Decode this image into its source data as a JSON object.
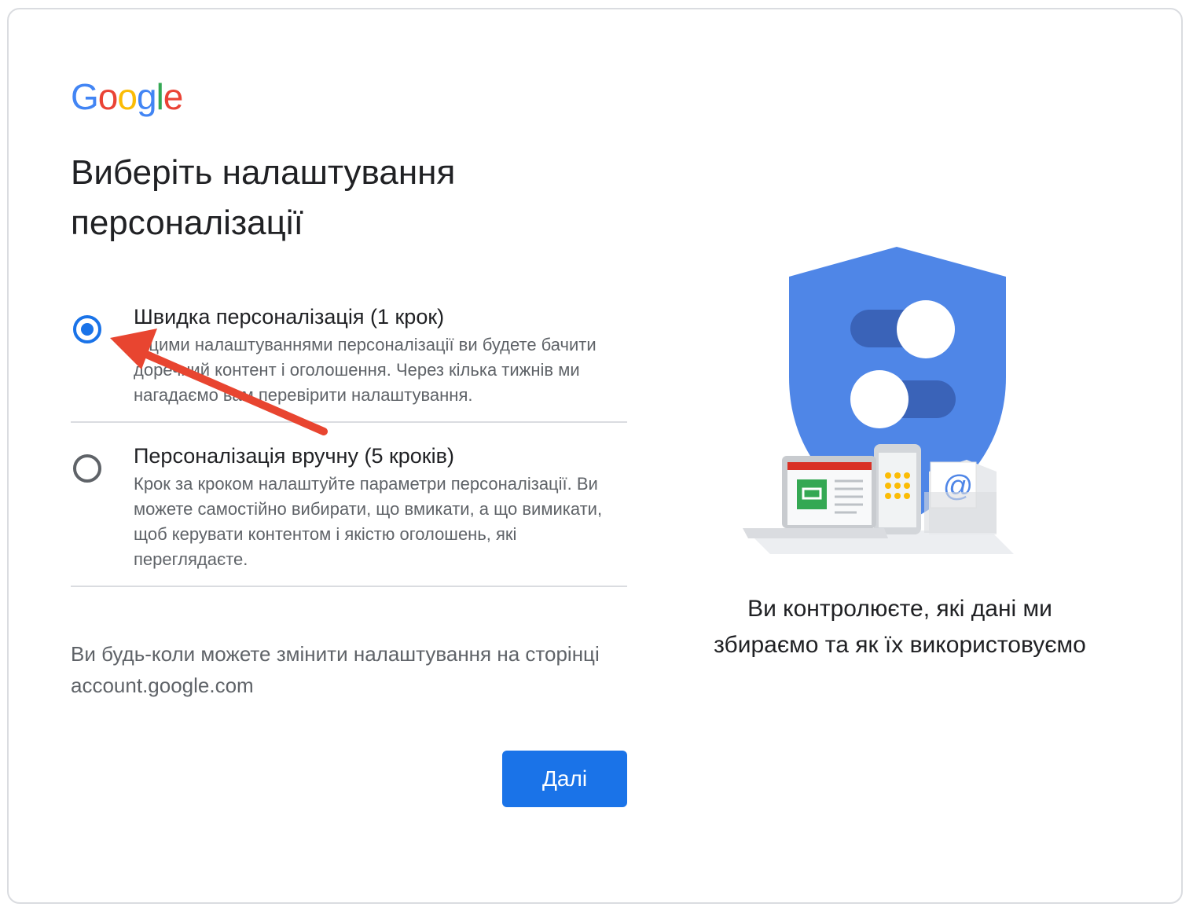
{
  "logo": {
    "letters": [
      {
        "char": "G",
        "color": "#4285F4"
      },
      {
        "char": "o",
        "color": "#EA4335"
      },
      {
        "char": "o",
        "color": "#FBBC05"
      },
      {
        "char": "g",
        "color": "#4285F4"
      },
      {
        "char": "l",
        "color": "#34A853"
      },
      {
        "char": "e",
        "color": "#EA4335"
      }
    ]
  },
  "title": "Виберіть налаштування персоналізації",
  "options": [
    {
      "title": "Швидка персоналізація (1 крок)",
      "description": "З цими налаштуваннями персоналізації ви будете бачити доречний контент і оголошення. Через кілька тижнів ми нагадаємо вам перевірити налаштування.",
      "selected": true
    },
    {
      "title": "Персоналізація вручну (5 кроків)",
      "description": "Крок за кроком налаштуйте параметри персоналізації. Ви можете самостійно вибирати, що вмикати, а що вимикати, щоб керувати контентом і якістю оголошень, які переглядаєте.",
      "selected": false
    }
  ],
  "note": "Ви будь-коли можете змінити налаштування на сторінці account.google.com",
  "next_button": "Далі",
  "caption": "Ви контролюєте, які дані ми збираємо та як їх використовуємо",
  "colors": {
    "accent": "#1a73e8",
    "shield": "#4f86e7",
    "annotation_arrow": "#e84530"
  }
}
